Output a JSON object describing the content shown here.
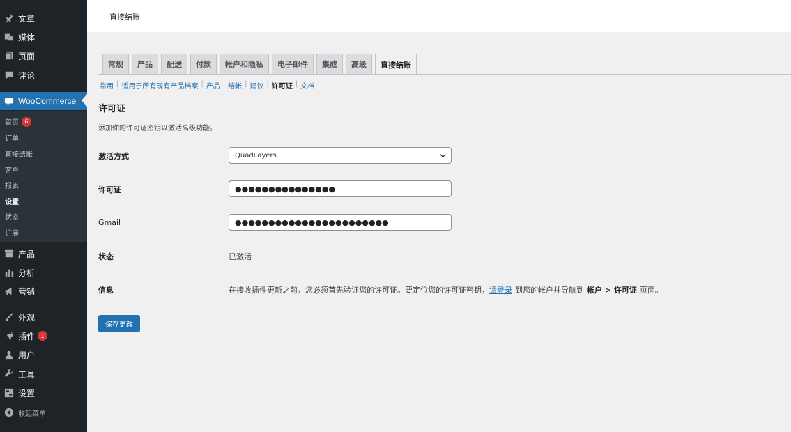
{
  "sidebar": {
    "posts": "文章",
    "media": "媒体",
    "pages": "页面",
    "comments": "评论",
    "woocommerce": "WooCommerce",
    "woo_sub": [
      {
        "label": "首页",
        "badge": "6"
      },
      {
        "label": "订单"
      },
      {
        "label": "直接结账"
      },
      {
        "label": "客户"
      },
      {
        "label": "报表"
      },
      {
        "label": "设置"
      },
      {
        "label": "状态"
      },
      {
        "label": "扩展"
      }
    ],
    "products": "产品",
    "analytics": "分析",
    "marketing": "营销",
    "appearance": "外观",
    "plugins": "插件",
    "plugins_badge": "1",
    "users": "用户",
    "tools": "工具",
    "settings": "设置",
    "collapse": "收起菜单"
  },
  "topbar": {
    "title": "直接结账"
  },
  "tabs": [
    "常规",
    "产品",
    "配送",
    "付款",
    "帐户和隐私",
    "电子邮件",
    "集成",
    "高级",
    "直接结账"
  ],
  "subnav": [
    "常用",
    "适用于所有现有产品档案",
    "产品",
    "结帐",
    "建议",
    "许可证",
    "文档"
  ],
  "section": {
    "title": "许可证",
    "description": "添加你的许可证密钥以激活高级功能。"
  },
  "form": {
    "activation_label": "激活方式",
    "activation_value": "QuadLayers",
    "license_label": "许可证",
    "license_value": "●●●●●●●●●●●●●●●",
    "gmail_label": "Gmail",
    "gmail_value": "●●●●●●●●●●●●●●●●●●●●●●●",
    "status_label": "状态",
    "status_value": "已激活",
    "info_label": "信息",
    "info_text_1": "在接收插件更新之前，您必须首先验证您的许可证。要定位您的许可证密钥，",
    "info_link": "请登录",
    "info_text_2": "到您的帐户并导航到",
    "info_bold": "帐户 > 许可证",
    "info_text_3": "页面。"
  },
  "save_button": "保存更改",
  "colors": {
    "sidebar": "#1d2327",
    "accent": "#2271b1",
    "badge": "#d63638"
  }
}
